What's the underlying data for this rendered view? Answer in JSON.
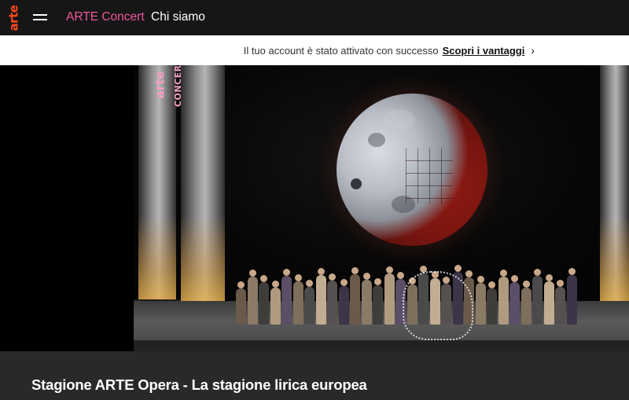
{
  "header": {
    "logo_text": "arte",
    "menu_icon": "hamburger-menu-icon",
    "nav": [
      {
        "label": "ARTE Concert",
        "color": "#f0569a"
      },
      {
        "label": "Chi siamo",
        "color": "#ffffff"
      }
    ]
  },
  "notice": {
    "message": "Il tuo account è stato attivato con successo",
    "cta_label": "Scopri i vantaggi",
    "cta_icon": "chevron-right-icon",
    "chevron": "›"
  },
  "player": {
    "watermark_top": "arte",
    "watermark_bottom": "CONCERT"
  },
  "page": {
    "title": "Stagione ARTE Opera - La stagione lirica europea"
  },
  "colors": {
    "nav_background": "#161616",
    "brand_orange": "#fa481c",
    "concert_pink": "#f0569a",
    "title_band": "#292929"
  }
}
